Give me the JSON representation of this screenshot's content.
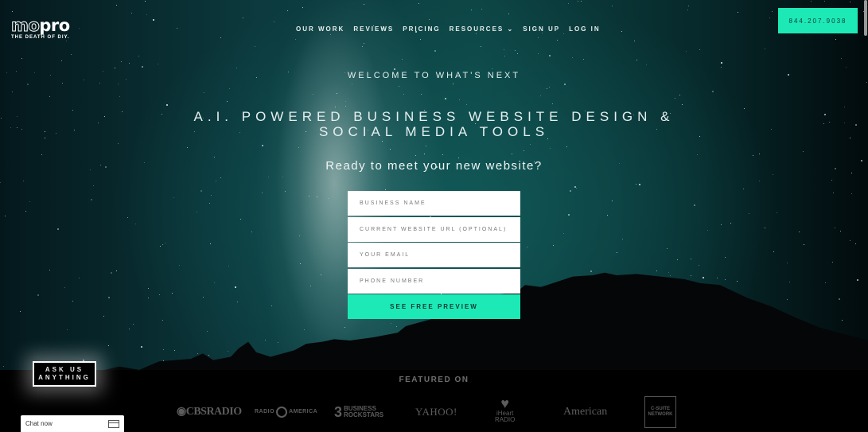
{
  "brand": {
    "logo_light": "mo",
    "logo_bold": "pro",
    "tagline": "THE DEATH OF DIY."
  },
  "nav": {
    "items": [
      {
        "label": "OUR WORK"
      },
      {
        "label": "REVIEWS"
      },
      {
        "label": "PRICING"
      },
      {
        "label": "RESOURCES ⌄"
      },
      {
        "label": "SIGN UP"
      },
      {
        "label": "LOG IN"
      }
    ],
    "phone": "844.207.9038"
  },
  "hero": {
    "eyebrow": "WELCOME TO WHAT'S NEXT",
    "headline_line1": "A.I. POWERED BUSINESS WEBSITE DESIGN &",
    "headline_line2": "SOCIAL MEDIA TOOLS",
    "subhead": "Ready to meet your new website?"
  },
  "form": {
    "business_name": {
      "placeholder": "BUSINESS NAME",
      "value": ""
    },
    "website_url": {
      "placeholder": "CURRENT WEBSITE URL (OPTIONAL)",
      "value": ""
    },
    "email": {
      "placeholder": "YOUR EMAIL",
      "value": ""
    },
    "phone": {
      "placeholder": "PHONE NUMBER",
      "value": ""
    },
    "submit_label": "SEE FREE PREVIEW"
  },
  "featured": {
    "title": "FEATURED ON",
    "logos": [
      {
        "name": "CBS RADIO",
        "text": "◉CBSRADIO"
      },
      {
        "name": "Radio America",
        "text_left": "RADIO",
        "text_right": "AMERICA"
      },
      {
        "name": "Business Rockstars",
        "mark": "3",
        "line1": "BUSINESS",
        "line2": "ROCKSTARS"
      },
      {
        "name": "Yahoo!",
        "text": "YAHOO!"
      },
      {
        "name": "iHeart Radio",
        "mark": "♥",
        "line1": "iHeart",
        "line2": "RADIO"
      },
      {
        "name": "American Media",
        "text": "American"
      },
      {
        "name": "C-Suite Network",
        "line1": "C-SUITE",
        "line2": "NETWORK"
      }
    ]
  },
  "ask": {
    "label_line1": "ASK US",
    "label_line2": "ANYTHING"
  },
  "chat": {
    "label": "Chat now",
    "icon": "window-icon"
  },
  "colors": {
    "accent": "#1de9b6",
    "accent_text": "#0b3a35",
    "featured_text": "#6e6e6e"
  }
}
